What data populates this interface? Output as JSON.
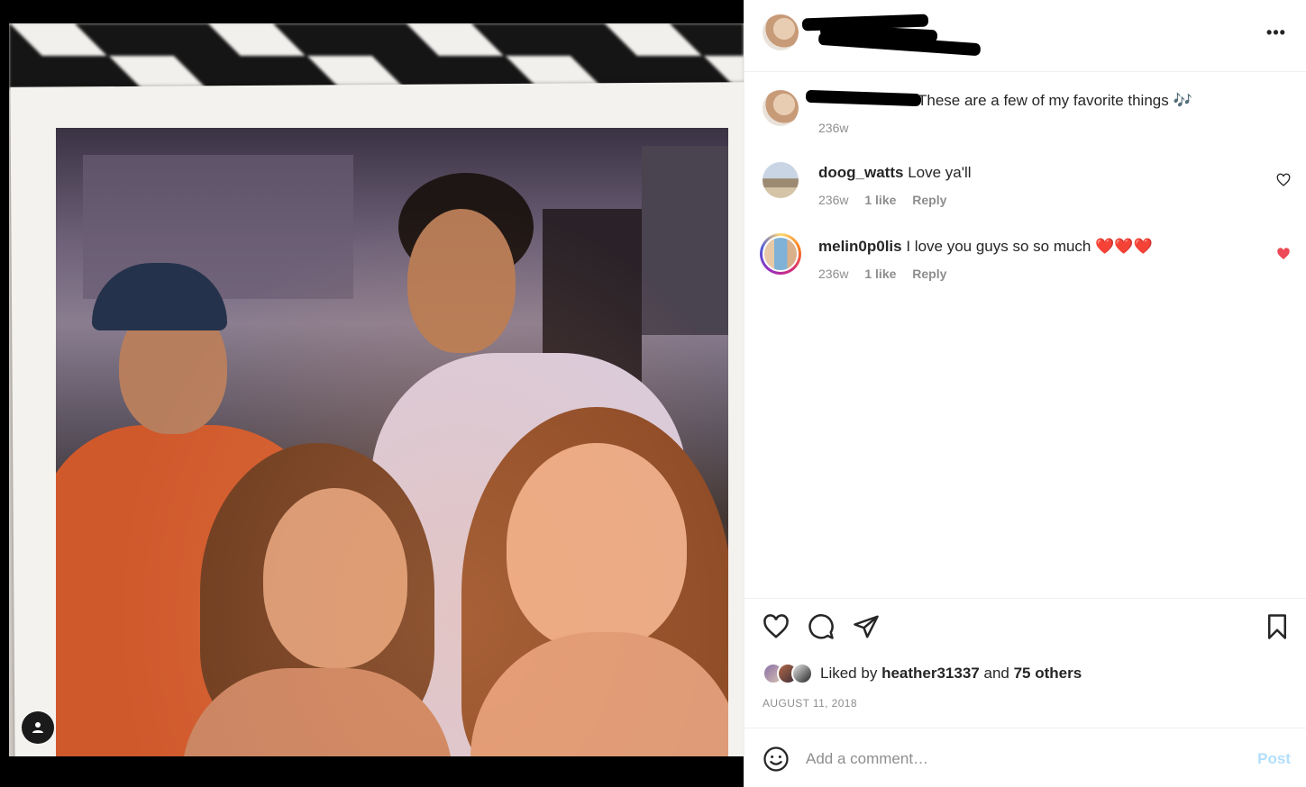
{
  "post": {
    "caption_text": "These are a few of my favorite things",
    "caption_emoji": "🎶",
    "caption_time": "236w"
  },
  "comments": [
    {
      "username": "doog_watts",
      "text": "Love ya'll",
      "time": "236w",
      "likes": "1 like",
      "reply_label": "Reply",
      "liked": false
    },
    {
      "username": "melin0p0lis",
      "text": "I love you guys so so much",
      "emoji": "❤️❤️❤️",
      "time": "236w",
      "likes": "1 like",
      "reply_label": "Reply",
      "liked": true
    }
  ],
  "likes": {
    "prefix": "Liked by",
    "user": "heather31337",
    "connector": "and",
    "others": "75 others"
  },
  "date": "AUGUST 11, 2018",
  "composer": {
    "placeholder": "Add a comment…",
    "post_label": "Post"
  },
  "icons": {
    "more": "more-options-icon",
    "like": "heart-icon",
    "comment": "comment-bubble-icon",
    "share": "paper-plane-icon",
    "save": "bookmark-icon",
    "emoji": "smiley-icon",
    "photo_tags": "user-tag-icon"
  },
  "colors": {
    "liked_heart": "#ed4956",
    "post_button": "#b2dffc",
    "muted_text": "#8e8e8e",
    "border": "#efefef"
  }
}
